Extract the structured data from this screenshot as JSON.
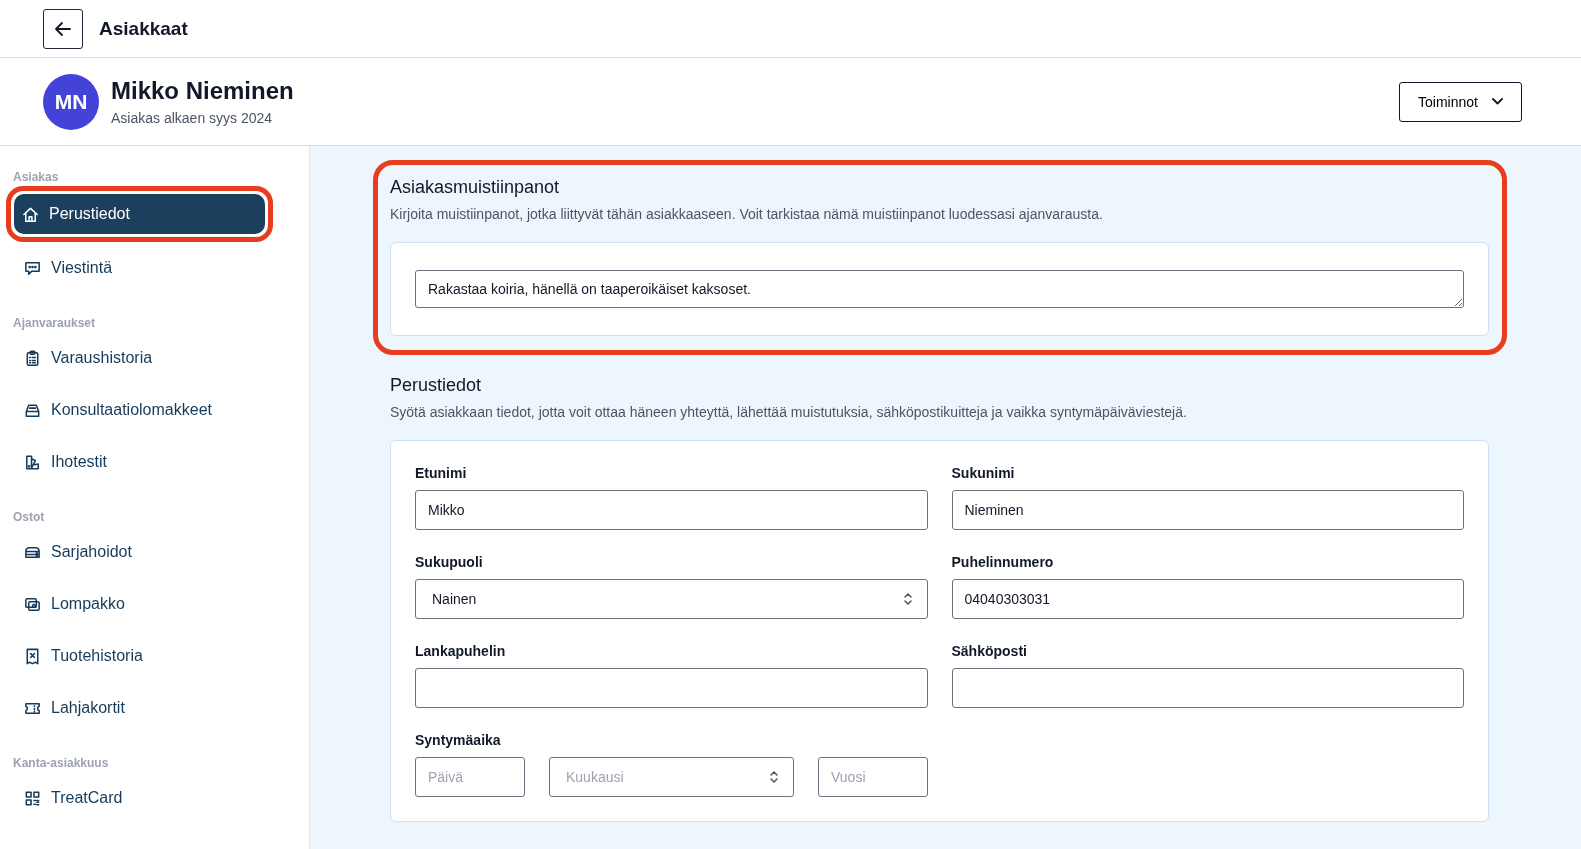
{
  "topbar": {
    "title": "Asiakkaat"
  },
  "profile": {
    "initials": "MN",
    "name": "Mikko Nieminen",
    "subtitle": "Asiakas alkaen syys 2024",
    "actions_button": "Toiminnot"
  },
  "sidebar": {
    "sections": [
      {
        "label": "Asiakas",
        "items": [
          {
            "label": "Perustiedot",
            "kind": "home",
            "selected": true,
            "annotated": true
          },
          {
            "label": "Viestintä",
            "kind": "chat",
            "selected": false,
            "annotated": false
          }
        ]
      },
      {
        "label": "Ajanvaraukset",
        "items": [
          {
            "label": "Varaushistoria",
            "kind": "clipboard",
            "selected": false,
            "annotated": false
          },
          {
            "label": "Konsultaatiolomakkeet",
            "kind": "tray",
            "selected": false,
            "annotated": false
          },
          {
            "label": "Ihotestit",
            "kind": "swatch",
            "selected": false,
            "annotated": false
          }
        ]
      },
      {
        "label": "Ostot",
        "items": [
          {
            "label": "Sarjahoidot",
            "kind": "stack",
            "selected": false,
            "annotated": false
          },
          {
            "label": "Lompakko",
            "kind": "wallet",
            "selected": false,
            "annotated": false
          },
          {
            "label": "Tuotehistoria",
            "kind": "receipt",
            "selected": false,
            "annotated": false
          },
          {
            "label": "Lahjakortit",
            "kind": "ticket",
            "selected": false,
            "annotated": false
          }
        ]
      },
      {
        "label": "Kanta-asiakkuus",
        "items": [
          {
            "label": "TreatCard",
            "kind": "qr",
            "selected": false,
            "annotated": false
          }
        ]
      }
    ]
  },
  "notes": {
    "annotated": true,
    "title": "Asiakasmuistiinpanot",
    "description": "Kirjoita muistiinpanot, jotka liittyvät tähän asiakkaaseen. Voit tarkistaa nämä muistiinpanot luodessasi ajanvarausta.",
    "value": "Rakastaa koiria, hänellä on taaperoikäiset kaksoset."
  },
  "basic_info": {
    "title": "Perustiedot",
    "description": "Syötä asiakkaan tiedot, jotta voit ottaa häneen yhteyttä, lähettää muistutuksia, sähköpostikuitteja ja vaikka syntymäpäiväviestejä.",
    "fields": [
      {
        "label": "Etunimi",
        "kind": "text",
        "value": "Mikko"
      },
      {
        "label": "Sukunimi",
        "kind": "text",
        "value": "Nieminen"
      },
      {
        "label": "Sukupuoli",
        "kind": "select",
        "value": "Nainen"
      },
      {
        "label": "Puhelinnumero",
        "kind": "text",
        "value": "04040303031"
      },
      {
        "label": "Lankapuhelin",
        "kind": "text"
      },
      {
        "label": "Sähköposti",
        "kind": "text"
      }
    ],
    "birthday": {
      "label": "Syntymäaika",
      "parts": [
        {
          "kind": "text",
          "placeholder": "Päivä"
        },
        {
          "kind": "select",
          "placeholder": "Kuukausi"
        },
        {
          "kind": "text",
          "placeholder": "Vuosi"
        }
      ]
    }
  }
}
